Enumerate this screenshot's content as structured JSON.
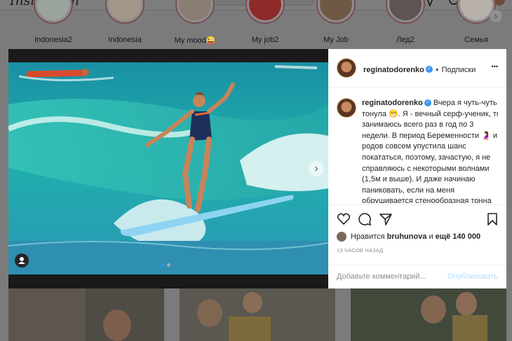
{
  "app": {
    "logo_text": "Instagram"
  },
  "stories": [
    {
      "label": "Indonesia2"
    },
    {
      "label": "Indonesia"
    },
    {
      "label": "My mood😜"
    },
    {
      "label": "My job2"
    },
    {
      "label": "My Job"
    },
    {
      "label": "Лед2"
    },
    {
      "label": "Семья"
    }
  ],
  "post": {
    "username": "reginatodorenko",
    "follow_label": "Подписки",
    "more_label": "•••",
    "caption": "Вчера я чуть-чуть тонула 😁. Я - вечный серф-ученик, тк занимаюсь всего раз в год по 3 недели. В период Беременности 🤰 и родов совсем упустила шанс покататься, поэтому, зачастую, я не справляюсь с некоторыми волнами (1,5м и выше). И даже начинаю паниковать, если на меня обрушивается стенообразная тонна воды. Так и",
    "likes_prefix": "Нравится",
    "likes_user": "bruhunova",
    "likes_and": "и",
    "likes_count": "ещё 140 000",
    "timestamp": "13 ЧАСОВ НАЗАД",
    "comment_placeholder": "Добавьте комментарий...",
    "publish_label": "Опубликовать",
    "verified_mark": "✓",
    "carousel_next": "›"
  },
  "colors": {
    "accent": "#3897f0",
    "publish": "#b2dffc",
    "text": "#262626",
    "muted": "#8e8e8e"
  },
  "icons": [
    "home-icon",
    "direct-icon",
    "explore-icon",
    "heart-icon",
    "comment-icon",
    "share-icon",
    "save-icon",
    "user-tag-icon",
    "chevron-right-icon"
  ]
}
